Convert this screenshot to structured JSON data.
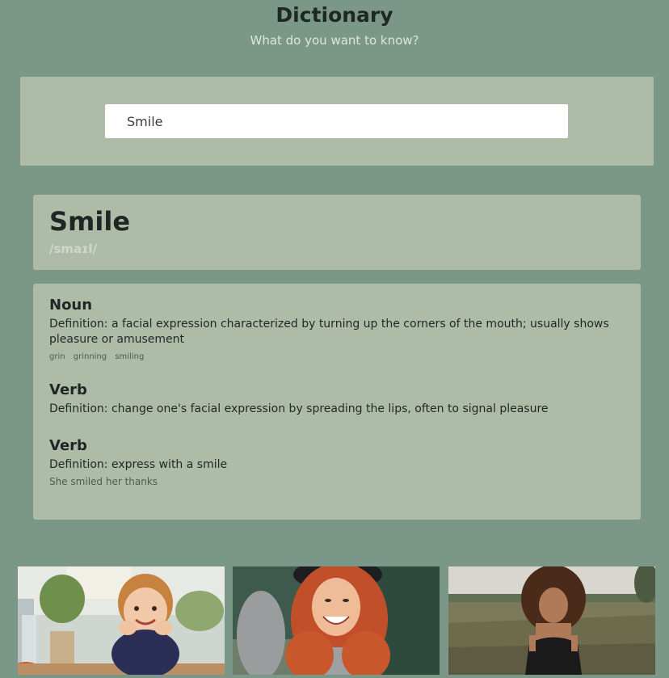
{
  "header": {
    "title": "Dictionary",
    "subtitle": "What do you want to know?"
  },
  "search": {
    "value": "Smile"
  },
  "word": {
    "title": "Smile",
    "phonetic": "/smaɪl/"
  },
  "meanings": [
    {
      "part_of_speech": "Noun",
      "definition": "Definition: a facial expression characterized by turning up the corners of the mouth; usually shows pleasure or amusement",
      "synonyms": [
        "grin",
        "grinning",
        "smiling"
      ]
    },
    {
      "part_of_speech": "Verb",
      "definition": "Definition: change one's facial expression by spreading the lips, often to signal pleasure"
    },
    {
      "part_of_speech": "Verb",
      "definition": "Definition: express with a smile",
      "example": "She smiled her thanks"
    }
  ],
  "photos": [
    {
      "subject": "smiling child"
    },
    {
      "subject": "laughing woman in hat"
    },
    {
      "subject": "woman with curly hair in field"
    }
  ]
}
